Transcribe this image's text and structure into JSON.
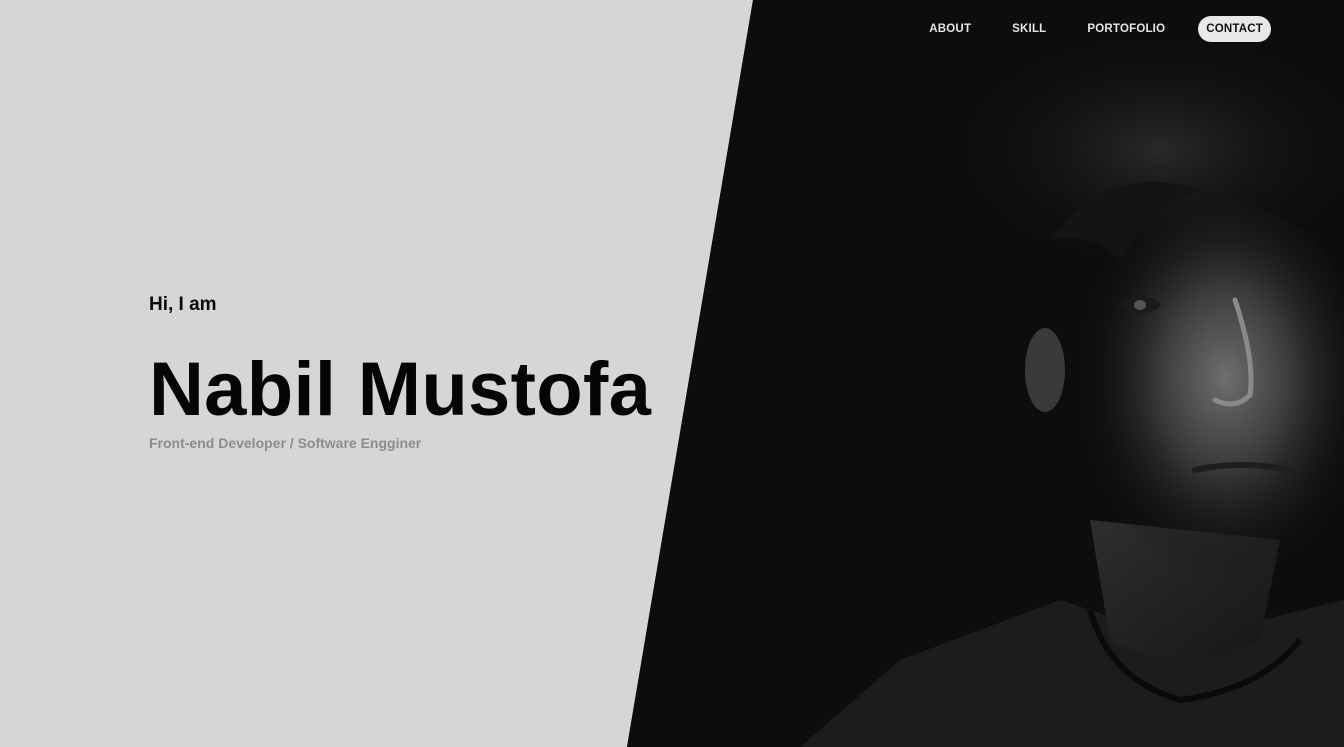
{
  "nav": {
    "items": [
      {
        "label": "ABOUT"
      },
      {
        "label": "SKILL"
      },
      {
        "label": "PORTOFOLIO"
      },
      {
        "label": "CONTACT"
      }
    ]
  },
  "hero": {
    "greeting": "Hi, I am",
    "name": "Nabil Mustofa",
    "role": "Front-end Developer / Software Engginer"
  },
  "colors": {
    "background": "#d6d6d6",
    "photo_background": "#0c0c0c",
    "text": "#050505",
    "subtitle": "#8c8c8c",
    "nav_active_bg": "#e8e8e8"
  },
  "photo": {
    "description_icon": "portrait-photo"
  }
}
